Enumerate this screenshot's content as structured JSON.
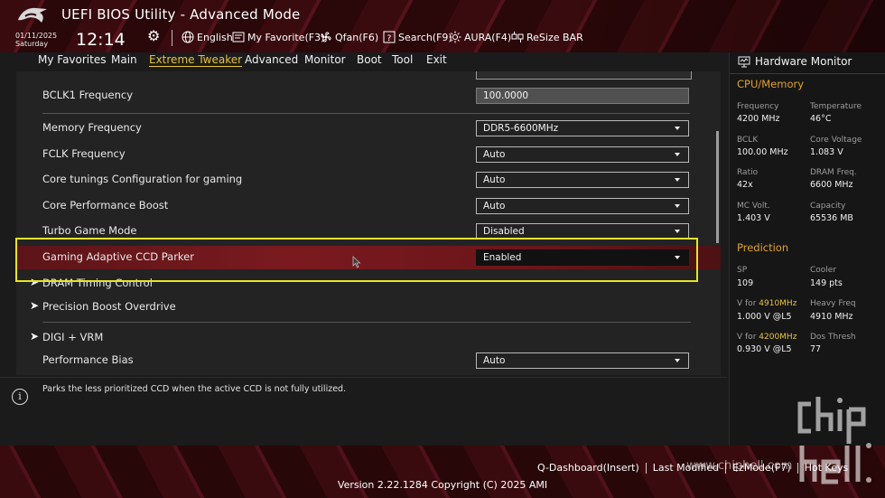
{
  "header": {
    "title": "UEFI BIOS Utility - Advanced Mode",
    "date": "01/11/2025",
    "weekday": "Saturday",
    "time": "12:14",
    "tools": [
      {
        "label": "English",
        "icon": "globe-icon"
      },
      {
        "label": "My Favorite(F3)",
        "icon": "favorite-icon"
      },
      {
        "label": "Qfan(F6)",
        "icon": "fan-icon"
      },
      {
        "label": "Search(F9)",
        "icon": "search-icon"
      },
      {
        "label": "AURA(F4)",
        "icon": "aura-icon"
      },
      {
        "label": "ReSize BAR",
        "icon": "resize-bar-icon"
      }
    ]
  },
  "menu": {
    "active": "Extreme Tweaker",
    "tabs": [
      "My Favorites",
      "Main",
      "Extreme Tweaker",
      "Advanced",
      "Monitor",
      "Boot",
      "Tool",
      "Exit"
    ]
  },
  "settings": {
    "bclk1": {
      "label": "BCLK1 Frequency",
      "value": "100.0000"
    },
    "memory_freq": {
      "label": "Memory Frequency",
      "value": "DDR5-6600MHz"
    },
    "fclk": {
      "label": "FCLK Frequency",
      "value": "Auto"
    },
    "core_tunings": {
      "label": "Core tunings Configuration for gaming",
      "value": "Auto"
    },
    "core_perf_boost": {
      "label": "Core Performance Boost",
      "value": "Auto"
    },
    "turbo_game": {
      "label": "Turbo Game Mode",
      "value": "Disabled"
    },
    "ccd_parker": {
      "label": "Gaming Adaptive CCD Parker",
      "value": "Enabled"
    },
    "dram_timing": {
      "label": "DRAM Timing Control"
    },
    "pbo": {
      "label": "Precision Boost Overdrive"
    },
    "digi_vrm": {
      "label": "DIGI + VRM"
    },
    "perf_bias": {
      "label": "Performance Bias",
      "value": "Auto"
    }
  },
  "help": {
    "text": "Parks the less prioritized CCD when the active CCD is not fully utilized."
  },
  "hardware_monitor": {
    "title": "Hardware Monitor",
    "cpu_memory": {
      "heading": "CPU/Memory",
      "frequency": {
        "label": "Frequency",
        "value": "4200 MHz"
      },
      "temperature": {
        "label": "Temperature",
        "value": "46°C"
      },
      "bclk": {
        "label": "BCLK",
        "value": "100.00 MHz"
      },
      "core_voltage": {
        "label": "Core Voltage",
        "value": "1.083 V"
      },
      "ratio": {
        "label": "Ratio",
        "value": "42x"
      },
      "dram_freq": {
        "label": "DRAM Freq.",
        "value": "6600 MHz"
      },
      "mc_volt": {
        "label": "MC Volt.",
        "value": "1.403 V"
      },
      "capacity": {
        "label": "Capacity",
        "value": "65536 MB"
      }
    },
    "prediction": {
      "heading": "Prediction",
      "sp": {
        "label": "SP",
        "value": "109"
      },
      "cooler": {
        "label": "Cooler",
        "value": "149 pts"
      },
      "v_for_4910_prefix": "V for ",
      "v_for_4910_freq": "4910MHz",
      "v_for_4910_value": "1.000 V @L5",
      "heavy_freq": {
        "label": "Heavy Freq",
        "value": "4910 MHz"
      },
      "v_for_4200_prefix": "V for ",
      "v_for_4200_freq": "4200MHz",
      "v_for_4200_value": "0.930 V @L5",
      "dos_thresh": {
        "label": "Dos Thresh",
        "value": "77"
      }
    }
  },
  "footer": {
    "q_dashboard": "Q-Dashboard(Insert)",
    "last_modified": "Last Modified",
    "ez_mode": "EzMode(F7)",
    "hot_keys": "Hot Keys",
    "version": "Version 2.22.1284 Copyright (C) 2025 AMI"
  },
  "watermark": {
    "url": "www.chiphell.com"
  },
  "colors": {
    "accent_yellow": "#e7c33a",
    "section_orange": "#e0a32a",
    "selection_red": "#7a1a1f",
    "highlight_box": "#e8e22b"
  }
}
